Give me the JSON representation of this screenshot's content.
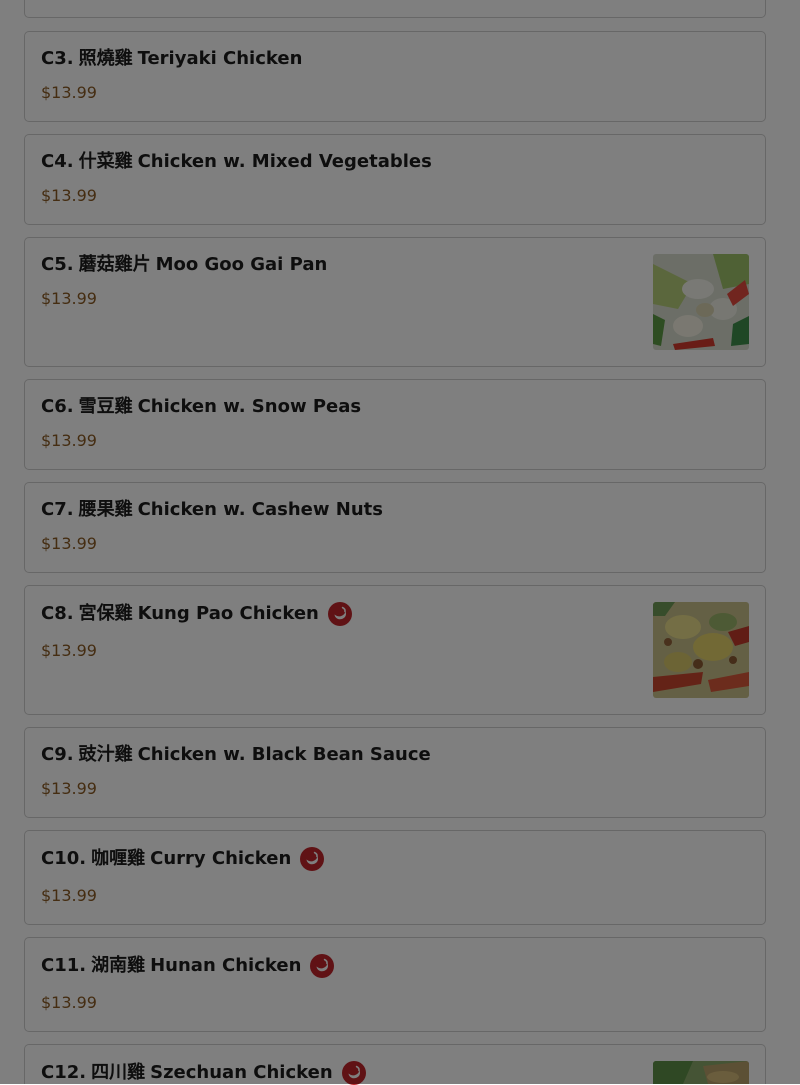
{
  "menu": {
    "items": [
      {
        "code": "C3.",
        "cn": "照燒雞",
        "name": "Teriyaki Chicken",
        "price": "$13.99",
        "spicy": false,
        "image": false
      },
      {
        "code": "C4.",
        "cn": "什菜雞",
        "name": "Chicken w. Mixed Vegetables",
        "price": "$13.99",
        "spicy": false,
        "image": false
      },
      {
        "code": "C5.",
        "cn": "蘑菇雞片",
        "name": "Moo Goo Gai Pan",
        "price": "$13.99",
        "spicy": false,
        "image": true
      },
      {
        "code": "C6.",
        "cn": "雪豆雞",
        "name": "Chicken w. Snow Peas",
        "price": "$13.99",
        "spicy": false,
        "image": false
      },
      {
        "code": "C7.",
        "cn": "腰果雞",
        "name": "Chicken w. Cashew Nuts",
        "price": "$13.99",
        "spicy": false,
        "image": false
      },
      {
        "code": "C8.",
        "cn": "宮保雞",
        "name": "Kung Pao Chicken",
        "price": "$13.99",
        "spicy": true,
        "image": true
      },
      {
        "code": "C9.",
        "cn": "豉汁雞",
        "name": "Chicken w. Black Bean Sauce",
        "price": "$13.99",
        "spicy": false,
        "image": false
      },
      {
        "code": "C10.",
        "cn": "咖喱雞",
        "name": "Curry Chicken",
        "price": "$13.99",
        "spicy": true,
        "image": false
      },
      {
        "code": "C11.",
        "cn": "湖南雞",
        "name": "Hunan Chicken",
        "price": "$13.99",
        "spicy": true,
        "image": false
      },
      {
        "code": "C12.",
        "cn": "四川雞",
        "name": "Szechuan Chicken",
        "price": "",
        "spicy": true,
        "image": true
      }
    ]
  },
  "icons": {
    "spicy": "chili-pepper-icon"
  },
  "colors": {
    "spicy_badge": "#c0252a",
    "price": "#8a5b24",
    "overlay": "rgba(0,0,0,0.5)"
  }
}
